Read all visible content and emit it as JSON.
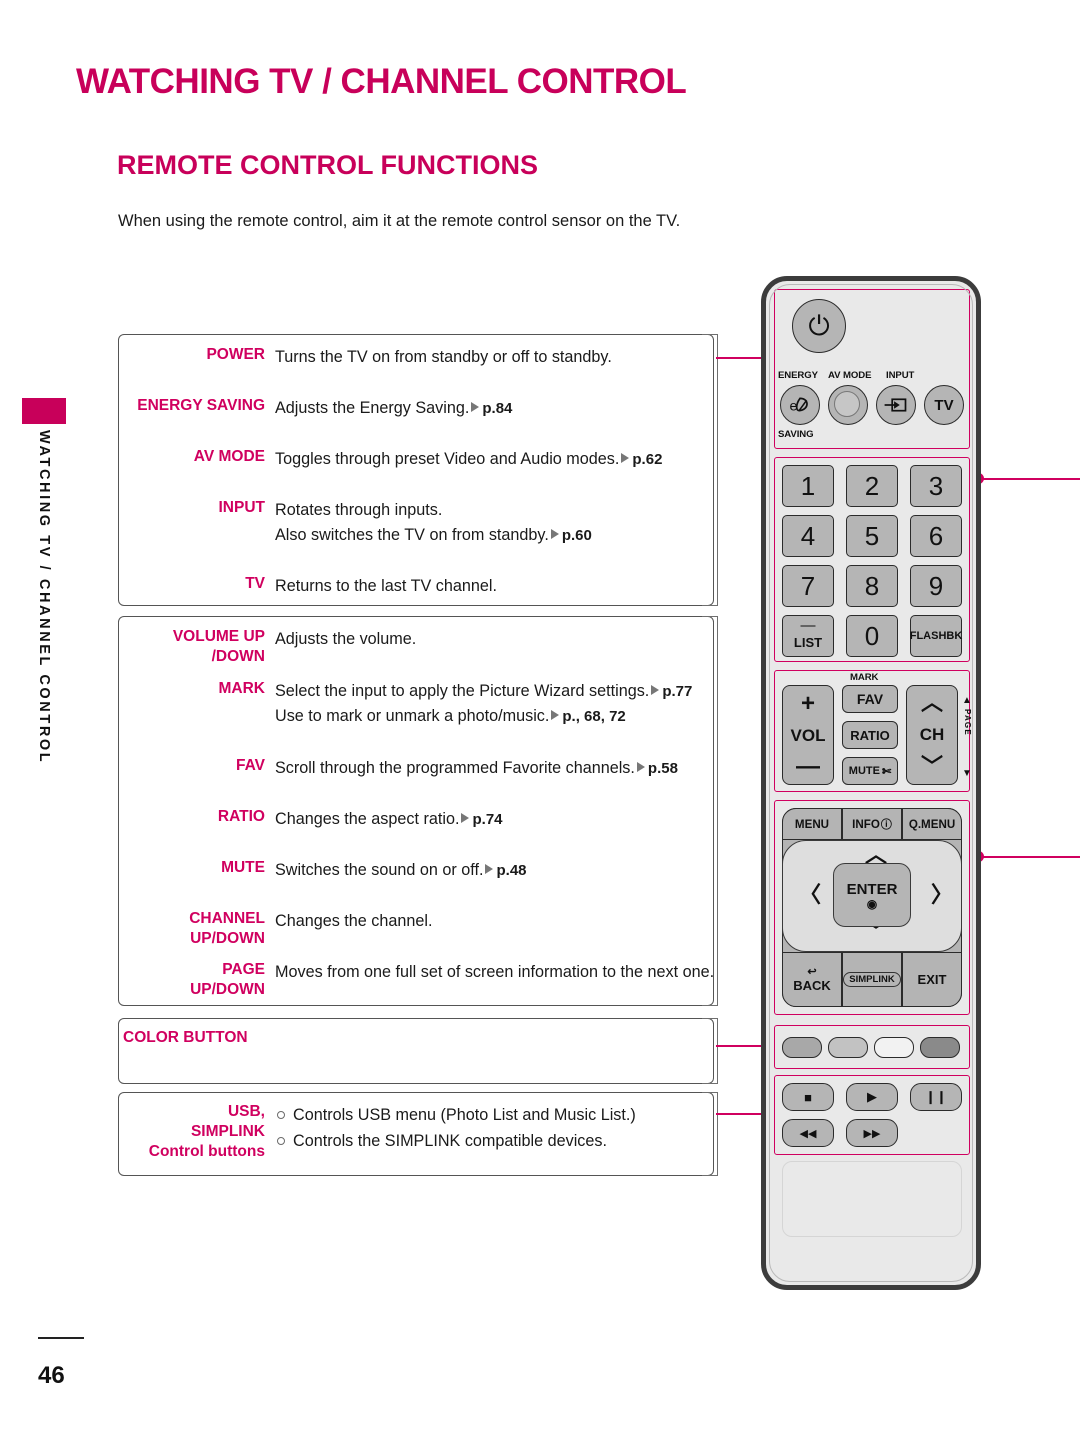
{
  "document": {
    "chapter_title": "WATCHING TV / CHANNEL CONTROL",
    "section_title": "REMOTE CONTROL FUNCTIONS",
    "intro": "When using the remote control, aim it at the remote control sensor on the TV.",
    "side_tab_label": "WATCHING TV / CHANNEL CONTROL",
    "page_number": "46",
    "accent_color": "#C8005A",
    "connector_color": "#D0005F"
  },
  "function_boxes": [
    {
      "id": "box1",
      "rows": [
        {
          "label": "POWER",
          "lines": [
            {
              "text": "Turns the TV on from standby or off to standby.",
              "page_ref": ""
            }
          ]
        },
        {
          "label": "ENERGY SAVING",
          "lines": [
            {
              "text": "Adjusts the Energy Saving.",
              "page_ref": "p.84"
            }
          ]
        },
        {
          "label": "AV MODE",
          "lines": [
            {
              "text": "Toggles through preset Video and Audio modes.",
              "page_ref": "p.62"
            }
          ]
        },
        {
          "label": "INPUT",
          "lines": [
            {
              "text": "Rotates through inputs.",
              "page_ref": ""
            },
            {
              "text": "Also switches the TV on from standby.",
              "page_ref": "p.60"
            }
          ]
        },
        {
          "label": "TV",
          "lines": [
            {
              "text": "Returns to the last TV channel.",
              "page_ref": ""
            }
          ]
        }
      ]
    },
    {
      "id": "box2",
      "rows": [
        {
          "label": "VOLUME UP\n/DOWN",
          "lines": [
            {
              "text": "Adjusts the volume.",
              "page_ref": ""
            }
          ]
        },
        {
          "label": "MARK",
          "lines": [
            {
              "text": "Select the input to apply the Picture Wizard settings.",
              "page_ref": "p.77"
            },
            {
              "text": "Use to mark or unmark a photo/music.",
              "page_ref": "p., 68, 72"
            }
          ]
        },
        {
          "label": "FAV",
          "lines": [
            {
              "text": "Scroll through the programmed Favorite channels.",
              "page_ref": "p.58"
            }
          ]
        },
        {
          "label": "RATIO",
          "lines": [
            {
              "text": "Changes the aspect ratio.",
              "page_ref": "p.74"
            }
          ]
        },
        {
          "label": "MUTE",
          "lines": [
            {
              "text": "Switches the sound on or off.",
              "page_ref": "p.48"
            }
          ]
        },
        {
          "label": "CHANNEL\nUP/DOWN",
          "lines": [
            {
              "text": "Changes the channel.",
              "page_ref": ""
            }
          ]
        },
        {
          "label": "PAGE\nUP/DOWN",
          "lines": [
            {
              "text": "Moves from one full set of screen information to the next one.",
              "page_ref": ""
            }
          ]
        }
      ]
    },
    {
      "id": "box3",
      "rows": [
        {
          "label": "COLOR BUTTON",
          "lines": []
        }
      ]
    },
    {
      "id": "box4",
      "rows": [
        {
          "label": "USB,\nSIMPLINK\nControl buttons",
          "bullets": [
            "Controls USB menu (Photo List and Music List.)",
            "Controls the SIMPLINK compatible devices."
          ]
        }
      ]
    }
  ],
  "remote": {
    "power_button": {
      "glyph": "⏻",
      "name": "power"
    },
    "mode_row": [
      {
        "caption_top": "ENERGY",
        "caption_bottom": "SAVING",
        "glyph": "e",
        "name": "energy-saving"
      },
      {
        "caption_top": "AV MODE",
        "caption_bottom": "",
        "glyph": "",
        "name": "av-mode"
      },
      {
        "caption_top": "INPUT",
        "caption_bottom": "",
        "glyph": "⊷",
        "name": "input"
      },
      {
        "caption_top": "",
        "caption_bottom": "",
        "glyph": "TV",
        "name": "tv"
      }
    ],
    "numpad": [
      "1",
      "2",
      "3",
      "4",
      "5",
      "6",
      "7",
      "8",
      "9",
      "LIST",
      "0",
      "FLASHBK"
    ],
    "vol_label": "VOL",
    "vol_plus": "+",
    "vol_minus": "—",
    "mark_label": "MARK",
    "mid_buttons": [
      "FAV",
      "RATIO",
      "MUTE"
    ],
    "mute_icon": "✄",
    "ch_label": "CH",
    "page_label": "PAGE",
    "top_nav": [
      "MENU",
      "INFO",
      "Q.MENU"
    ],
    "info_icon": "ⓘ",
    "enter_label": "ENTER",
    "enter_icon": "◉",
    "bottom_nav": [
      "BACK",
      "SIMPLINK",
      "EXIT"
    ],
    "back_icon": "↩",
    "simplink_label": "SIMPLINK",
    "color_buttons": [
      "#a8a8a8",
      "#c2c2c2",
      "#f2f2f2",
      "#8a8a8a"
    ],
    "media_buttons": [
      "■",
      "▶",
      "❙❙",
      "◀◀",
      "▶▶"
    ]
  }
}
